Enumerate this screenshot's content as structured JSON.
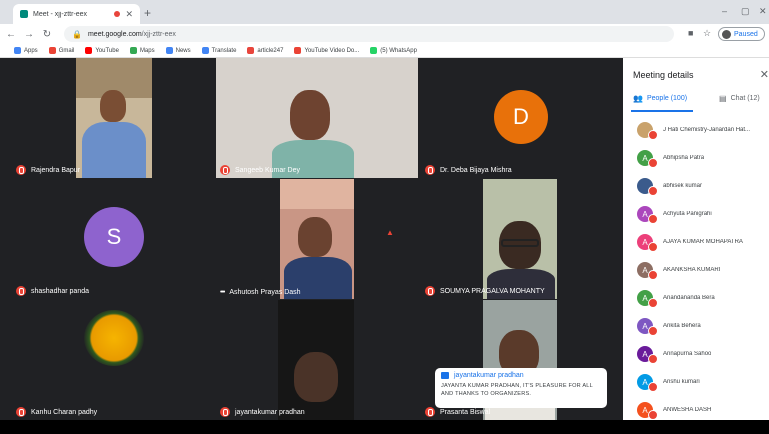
{
  "browser": {
    "tab_title": "Meet - xjj-zttr-eex",
    "url_domain": "meet.google.com",
    "url_path": "/xjj-zttr-eex",
    "profile_status": "Paused",
    "bookmarks": [
      {
        "label": "Apps",
        "color": "#4285f4"
      },
      {
        "label": "Gmail",
        "color": "#ea4335"
      },
      {
        "label": "YouTube",
        "color": "#ff0000"
      },
      {
        "label": "Maps",
        "color": "#34a853"
      },
      {
        "label": "News",
        "color": "#4285f4"
      },
      {
        "label": "Translate",
        "color": "#4285f4"
      },
      {
        "label": "article247",
        "color": "#e8453c"
      },
      {
        "label": "YouTube Video Do...",
        "color": "#ea4335"
      },
      {
        "label": "(5) WhatsApp",
        "color": "#25d366"
      }
    ]
  },
  "tiles": [
    {
      "name": "Rajendra Bapur",
      "indicator": "muted"
    },
    {
      "name": "Sangeeb Kumar Dey",
      "indicator": "muted"
    },
    {
      "name": "Dr. Deba Bijaya Mishra",
      "indicator": "muted",
      "initial": "D",
      "avatar_color": "#e8710a"
    },
    {
      "name": "shashadhar panda",
      "indicator": "muted",
      "initial": "S",
      "avatar_color": "#8e63ce"
    },
    {
      "name": "Ashutosh Prayas Dash",
      "indicator": "speaking"
    },
    {
      "name": "SOUMYA PRAGALVA MOHANTY",
      "indicator": "muted"
    },
    {
      "name": "Kanhu Charan padhy",
      "indicator": "muted"
    },
    {
      "name": "jayantakumar pradhan",
      "indicator": "muted"
    },
    {
      "name": "Prasanta Biswal",
      "indicator": "muted"
    }
  ],
  "toast": {
    "sender": "jayantakumar pradhan",
    "message": "JAYANTA KUMAR PRADHAN, IT'S PLEASURE FOR ALL AND THANKS TO ORGANIZERS."
  },
  "panel": {
    "title": "Meeting details",
    "people_tab": "People (100)",
    "chat_tab": "Chat (12)",
    "participants": [
      {
        "name": "J Hati Chemistry-Janardan Hat...",
        "initial": "",
        "color": "#c9a26b"
      },
      {
        "name": "Abhipsha Patra",
        "initial": "A",
        "color": "#43a047"
      },
      {
        "name": "abhisek kumar",
        "initial": "",
        "color": "#3b5b8c"
      },
      {
        "name": "Achyuta Panigrahi",
        "initial": "A",
        "color": "#ab47bc"
      },
      {
        "name": "AJAYA KUMAR MOHAPATRA",
        "initial": "A",
        "color": "#ec407a"
      },
      {
        "name": "AKANKSHA KUMARI",
        "initial": "A",
        "color": "#8d6e63"
      },
      {
        "name": "Anandananda Bera",
        "initial": "A",
        "color": "#43a047"
      },
      {
        "name": "Ankita Behera",
        "initial": "A",
        "color": "#7e57c2"
      },
      {
        "name": "Annapurna Sahoo",
        "initial": "A",
        "color": "#6a1b9a"
      },
      {
        "name": "Anshu kumari",
        "initial": "A",
        "color": "#039be5"
      },
      {
        "name": "ANWESHA DASH",
        "initial": "A",
        "color": "#f4511e"
      }
    ]
  }
}
